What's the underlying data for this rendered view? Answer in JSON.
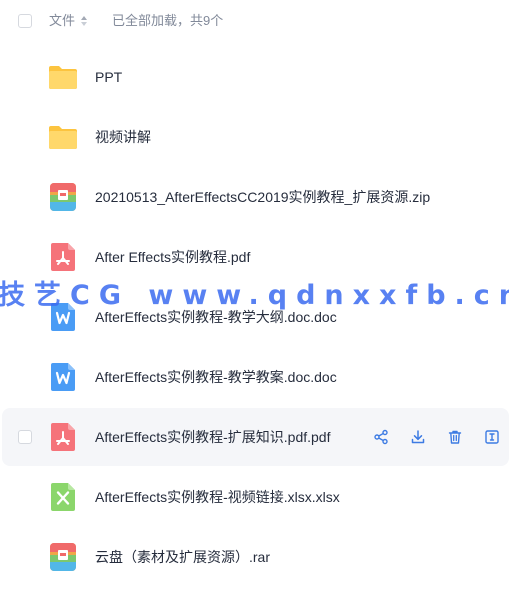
{
  "header": {
    "column_filename": "文件",
    "status": "已全部加载，共9个"
  },
  "files": [
    {
      "name": "PPT",
      "icon": "folder-icon"
    },
    {
      "name": "视频讲解",
      "icon": "folder-icon"
    },
    {
      "name": "20210513_AfterEffectsCC2019实例教程_扩展资源.zip",
      "icon": "zip-icon"
    },
    {
      "name": "After Effects实例教程.pdf",
      "icon": "pdf-icon"
    },
    {
      "name": "AfterEffects实例教程-教学大纲.doc.doc",
      "icon": "word-icon"
    },
    {
      "name": "AfterEffects实例教程-教学教案.doc.doc",
      "icon": "word-icon"
    },
    {
      "name": "AfterEffects实例教程-扩展知识.pdf.pdf",
      "icon": "pdf-icon"
    },
    {
      "name": "AfterEffects实例教程-视频链接.xlsx.xlsx",
      "icon": "excel-icon"
    },
    {
      "name": "云盘（素材及扩展资源）.rar",
      "icon": "zip-icon"
    }
  ],
  "hovered_row_actions": [
    "share-icon",
    "download-icon",
    "delete-icon",
    "rename-icon"
  ],
  "watermark": "技艺CG www.qdnxxfb.cn",
  "colors": {
    "folder": "#ffd35a",
    "pdf": "#f5737a",
    "word": "#4a9cf5",
    "excel": "#8bd66b",
    "action": "#3d7be3",
    "text": "#262d3d",
    "muted": "#818999"
  }
}
